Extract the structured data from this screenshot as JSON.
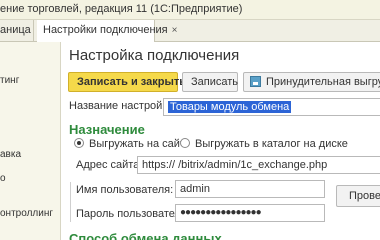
{
  "window": {
    "title": "ение торговлей, редакция 11  (1С:Предприятие)"
  },
  "tabs": [
    {
      "label": "аница"
    },
    {
      "label": "Настройки подключения",
      "close": "×"
    }
  ],
  "sidebar": {
    "items": [
      "тинг",
      "авка",
      "о",
      "онтроллинг"
    ]
  },
  "form": {
    "title": "Настройка подключения",
    "buttons": {
      "save_close": "Записать и закрыть",
      "write": "Записать",
      "upload": "Принудительная выгрузка к"
    },
    "settings_name_label": "Название настройки:",
    "settings_name_value": "Товары модуль обмена",
    "section_purpose": "Назначение",
    "radio_site": "Выгружать на сайт",
    "radio_catalog": "Выгружать в каталог на диске",
    "site_address_label": "Адрес сайта:",
    "site_address_value": "https://                    /bitrix/admin/1c_exchange.php",
    "username_label": "Имя пользователя:",
    "username_value": "admin",
    "password_label": "Пароль пользователя:",
    "password_value": "●●●●●●●●●●●●●●●●",
    "check_button": "Провер",
    "section_exchange": "Способ обмена данных"
  }
}
